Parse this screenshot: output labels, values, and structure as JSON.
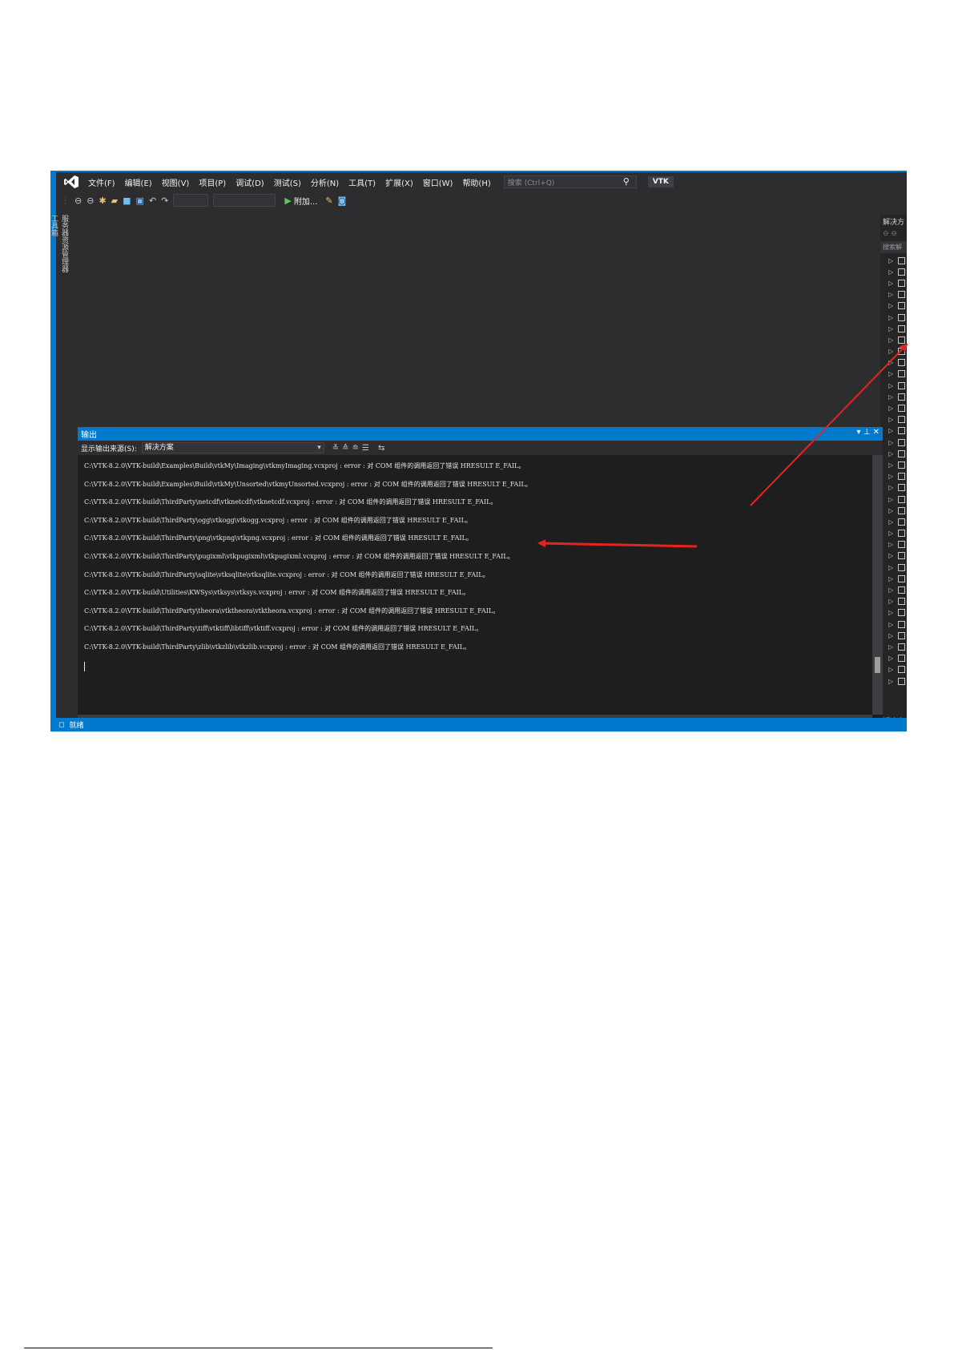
{
  "menubar": {
    "items": [
      "文件(F)",
      "编辑(E)",
      "视图(V)",
      "项目(P)",
      "调试(D)",
      "测试(S)",
      "分析(N)",
      "工具(T)",
      "扩展(X)",
      "窗口(W)",
      "帮助(H)"
    ],
    "search_placeholder": "搜索 (Ctrl+Q)",
    "project_name": "VTK"
  },
  "toolbar": {
    "run_label": "附加..."
  },
  "left_tabs": [
    "服务器资源管理器",
    "工具箱"
  ],
  "right_panel": {
    "title": "解决方",
    "search_label": "搜索解",
    "footer": "解决方"
  },
  "output": {
    "title": "输出",
    "source_label": "显示输出来源(S):",
    "source_value": "解决方案",
    "lines": [
      "C:\\VTK-8.2.0\\VTK-build\\Examples\\Build\\vtkMy\\Imaging\\vtkmyImaging.vcxproj : error  : 对 COM 组件的调用返回了错误 HRESULT E_FAIL。",
      "C:\\VTK-8.2.0\\VTK-build\\Examples\\Build\\vtkMy\\Unsorted\\vtkmyUnsorted.vcxproj : error  : 对 COM 组件的调用返回了错误 HRESULT E_FAIL。",
      "C:\\VTK-8.2.0\\VTK-build\\ThirdParty\\netcdf\\vtknetcdf\\vtknetcdf.vcxproj : error  : 对 COM 组件的调用返回了错误 HRESULT E_FAIL。",
      "C:\\VTK-8.2.0\\VTK-build\\ThirdParty\\ogg\\vtkogg\\vtkogg.vcxproj : error  : 对 COM 组件的调用返回了错误 HRESULT E_FAIL。",
      "C:\\VTK-8.2.0\\VTK-build\\ThirdParty\\png\\vtkpng\\vtkpng.vcxproj : error  : 对 COM 组件的调用返回了错误 HRESULT E_FAIL。",
      "C:\\VTK-8.2.0\\VTK-build\\ThirdParty\\pugixml\\vtkpugixml\\vtkpugixml.vcxproj : error  : 对 COM 组件的调用返回了错误 HRESULT E_FAIL。",
      "C:\\VTK-8.2.0\\VTK-build\\ThirdParty\\sqlite\\vtksqlite\\vtksqlite.vcxproj : error  : 对 COM 组件的调用返回了错误 HRESULT E_FAIL。",
      "C:\\VTK-8.2.0\\VTK-build\\Utilities\\KWSys\\vtksys\\vtksys.vcxproj : error  : 对 COM 组件的调用返回了错误 HRESULT E_FAIL。",
      "C:\\VTK-8.2.0\\VTK-build\\ThirdParty\\theora\\vtktheora\\vtktheora.vcxproj : error  : 对 COM 组件的调用返回了错误 HRESULT E_FAIL。",
      "C:\\VTK-8.2.0\\VTK-build\\ThirdParty\\tiff\\vtktiff\\libtiff\\vtktiff.vcxproj : error  : 对 COM 组件的调用返回了错误 HRESULT E_FAIL。",
      "C:\\VTK-8.2.0\\VTK-build\\ThirdParty\\zlib\\vtkzlib\\vtkzlib.vcxproj : error  : 对 COM 组件的调用返回了错误 HRESULT E_FAIL。"
    ]
  },
  "statusbar": {
    "text": "就绪"
  },
  "colors": {
    "accent": "#007acc",
    "annotation_arrow": "#e52421",
    "background": "#2d2d30"
  }
}
